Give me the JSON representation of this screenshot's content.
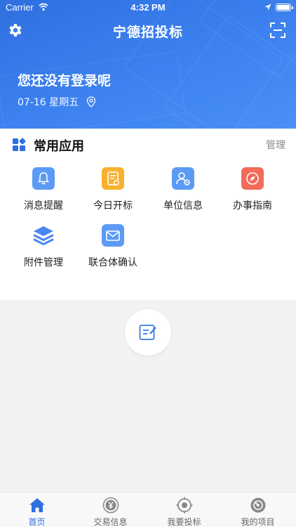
{
  "status_bar": {
    "carrier": "Carrier",
    "time": "4:32 PM"
  },
  "navbar": {
    "title": "宁德招投标",
    "settings_icon": "gear-icon",
    "scan_icon": "scan-icon"
  },
  "login": {
    "title": "您还没有登录呢",
    "date": "07-16 星期五"
  },
  "apps_section": {
    "title": "常用应用",
    "manage_label": "管理",
    "items": [
      {
        "label": "消息提醒",
        "icon": "bell-icon",
        "color": "#4e8df5"
      },
      {
        "label": "今日开标",
        "icon": "calendar-doc-icon",
        "color": "#f5a623"
      },
      {
        "label": "单位信息",
        "icon": "user-badge-icon",
        "color": "#4e8df5"
      },
      {
        "label": "办事指南",
        "icon": "compass-icon",
        "color": "#f26b5b"
      },
      {
        "label": "附件管理",
        "icon": "layers-icon",
        "color": "#4e8df5"
      },
      {
        "label": "联合体确认",
        "icon": "mail-icon",
        "color": "#4e8df5"
      }
    ]
  },
  "tabbar": {
    "tabs": [
      {
        "label": "首页",
        "icon": "home-icon",
        "active": true
      },
      {
        "label": "交易信息",
        "icon": "yen-coin-icon",
        "active": false
      },
      {
        "label": "我要投标",
        "icon": "target-icon",
        "active": false
      },
      {
        "label": "我的项目",
        "icon": "project-icon",
        "active": false
      }
    ]
  },
  "colors": {
    "accent": "#2f6fe0",
    "header": "#3d82f0",
    "background": "#f2f2f2"
  }
}
